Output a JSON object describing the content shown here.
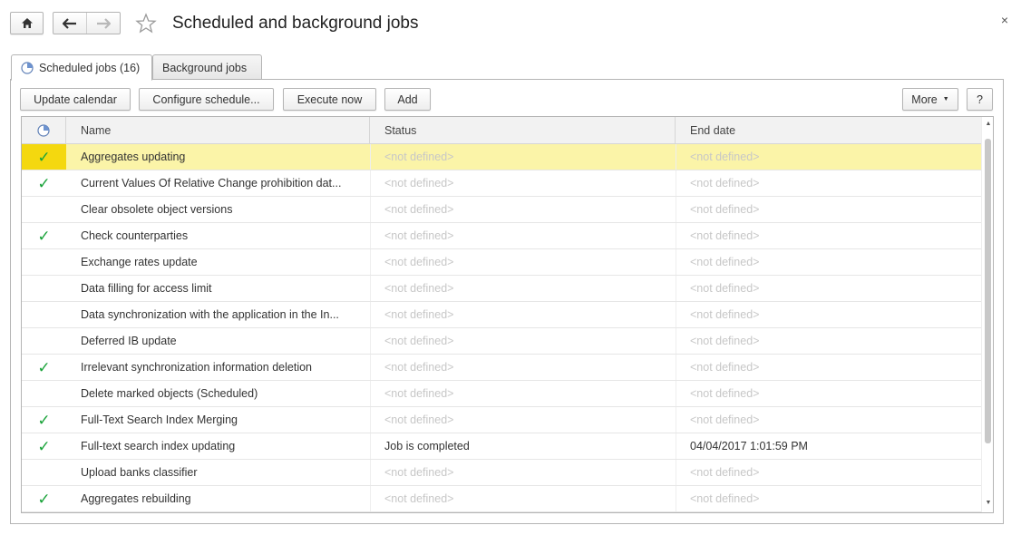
{
  "window": {
    "title": "Scheduled and background jobs",
    "close_glyph": "×",
    "home_icon": "home-icon",
    "back_icon": "arrow-left-icon",
    "forward_icon": "arrow-right-icon",
    "favorite_icon": "star-icon"
  },
  "tabs": [
    {
      "label": "Scheduled jobs (16)",
      "icon": "clock-icon",
      "active": true
    },
    {
      "label": "Background jobs",
      "active": false
    }
  ],
  "toolbar": {
    "update_calendar": "Update calendar",
    "configure_schedule": "Configure schedule...",
    "execute_now": "Execute now",
    "add": "Add",
    "more": "More",
    "help": "?"
  },
  "table": {
    "columns": {
      "icon": "clock-icon",
      "name": "Name",
      "status": "Status",
      "end_date": "End date"
    },
    "rows": [
      {
        "checked": true,
        "name": "Aggregates updating",
        "status": "<not defined>",
        "end_date": "<not defined>",
        "selected": true
      },
      {
        "checked": true,
        "name": "Current Values Of Relative Change prohibition dat...",
        "status": "<not defined>",
        "end_date": "<not defined>"
      },
      {
        "checked": false,
        "name": "Clear obsolete object versions",
        "status": "<not defined>",
        "end_date": "<not defined>"
      },
      {
        "checked": true,
        "name": "Check counterparties",
        "status": "<not defined>",
        "end_date": "<not defined>"
      },
      {
        "checked": false,
        "name": "Exchange rates update",
        "status": "<not defined>",
        "end_date": "<not defined>"
      },
      {
        "checked": false,
        "name": "Data filling for access limit",
        "status": "<not defined>",
        "end_date": "<not defined>"
      },
      {
        "checked": false,
        "name": "Data synchronization with the application in the In...",
        "status": "<not defined>",
        "end_date": "<not defined>"
      },
      {
        "checked": false,
        "name": "Deferred IB update",
        "status": "<not defined>",
        "end_date": "<not defined>"
      },
      {
        "checked": true,
        "name": "Irrelevant synchronization information deletion",
        "status": "<not defined>",
        "end_date": "<not defined>"
      },
      {
        "checked": false,
        "name": "Delete marked objects (Scheduled)",
        "status": "<not defined>",
        "end_date": "<not defined>"
      },
      {
        "checked": true,
        "name": "Full-Text Search Index Merging",
        "status": "<not defined>",
        "end_date": "<not defined>"
      },
      {
        "checked": true,
        "name": "Full-text search index updating",
        "status": "Job is completed",
        "end_date": "04/04/2017 1:01:59 PM"
      },
      {
        "checked": false,
        "name": "Upload banks classifier",
        "status": "<not defined>",
        "end_date": "<not defined>"
      },
      {
        "checked": true,
        "name": "Aggregates rebuilding",
        "status": "<not defined>",
        "end_date": "<not defined>"
      }
    ]
  },
  "colors": {
    "selection_row": "#fbf4a8",
    "selection_marker": "#f4d80f",
    "check": "#1aa33a",
    "muted_text": "#c7c7c7"
  }
}
